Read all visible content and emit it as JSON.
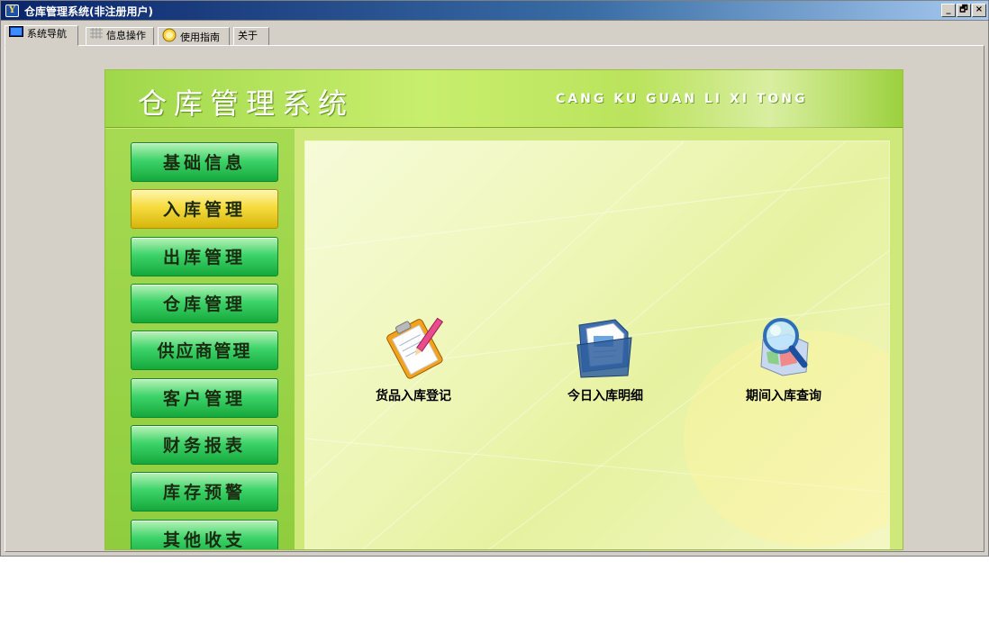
{
  "window": {
    "title": "仓库管理系统(非注册用户)",
    "controls": [
      "_",
      "🗗",
      "×"
    ]
  },
  "tabs": [
    {
      "label": "系统导航",
      "icon": "monitor-icon",
      "active": true
    },
    {
      "label": "信息操作",
      "icon": "grid-icon",
      "active": false
    },
    {
      "label": "使用指南",
      "icon": "help-icon",
      "active": false
    },
    {
      "label": "关于",
      "icon": "",
      "active": false
    }
  ],
  "app": {
    "title": "仓库管理系统",
    "subtitle": "CANG KU GUAN LI XI TONG"
  },
  "menu": [
    {
      "label": "基础信息",
      "active": false
    },
    {
      "label": "入库管理",
      "active": true
    },
    {
      "label": "出库管理",
      "active": false
    },
    {
      "label": "仓库管理",
      "active": false
    },
    {
      "label": "供应商管理",
      "active": false
    },
    {
      "label": "客户管理",
      "active": false
    },
    {
      "label": "财务报表",
      "active": false
    },
    {
      "label": "库存预警",
      "active": false
    },
    {
      "label": "其他收支",
      "active": false
    }
  ],
  "functions": [
    {
      "label": "货品入库登记",
      "icon": "clipboard-pencil-icon"
    },
    {
      "label": "今日入库明细",
      "icon": "document-folder-icon"
    },
    {
      "label": "期间入库查询",
      "icon": "magnifier-map-icon"
    }
  ],
  "colors": {
    "title_bar": "#0a246a",
    "menu_green": "#3fd46a",
    "menu_active_gold": "#f6dc3e",
    "panel_background": "#cfe87a"
  }
}
